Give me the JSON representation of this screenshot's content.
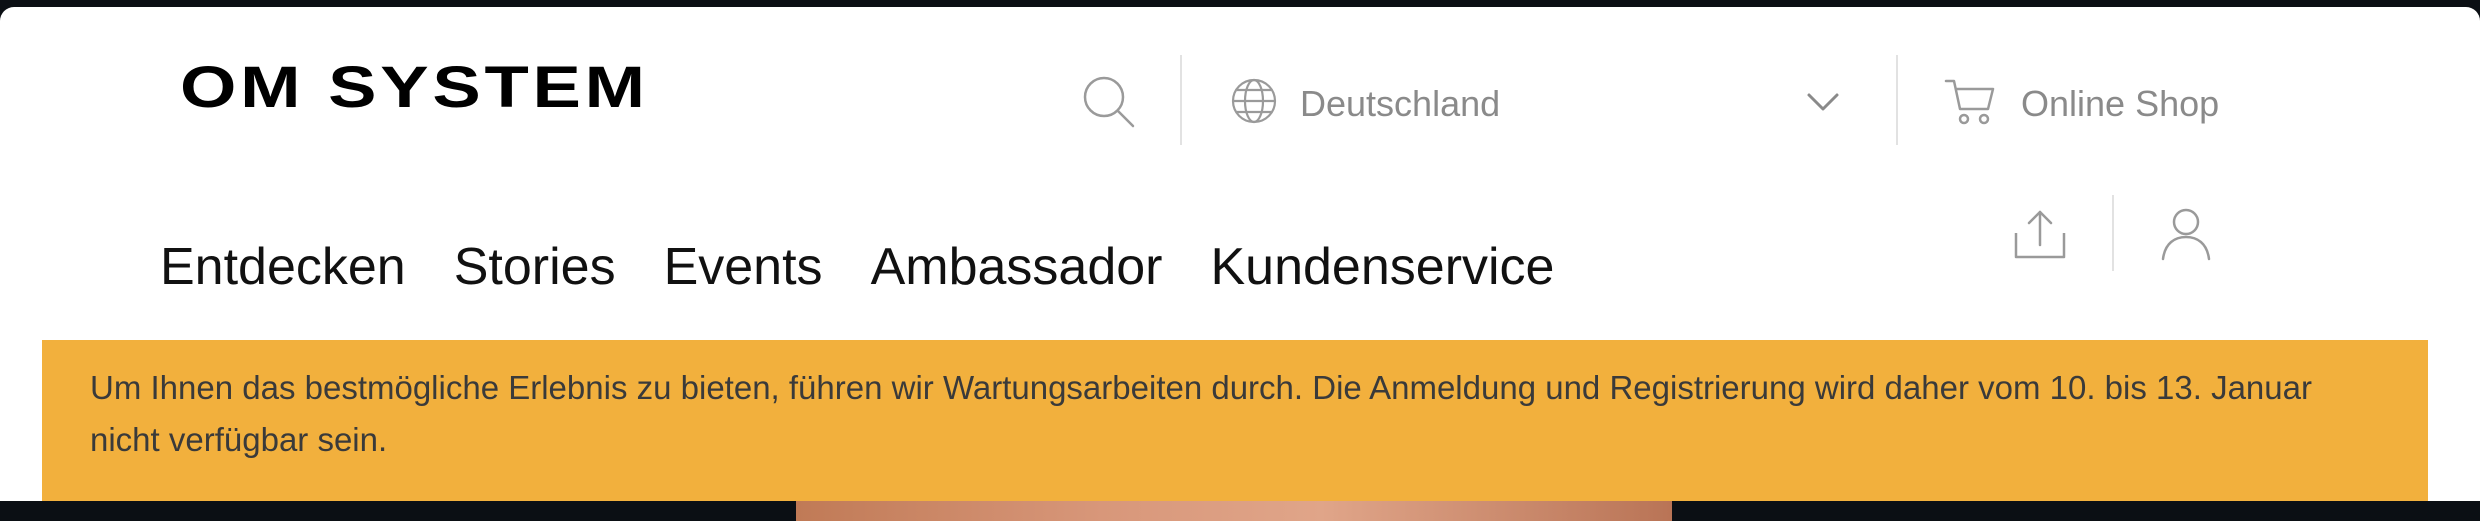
{
  "header": {
    "logo_text": "OM SYSTEM",
    "icons": {
      "search": "search-icon",
      "globe": "globe-icon",
      "chevron": "chevron-down-icon",
      "cart": "cart-icon",
      "share": "share-icon",
      "user": "user-icon"
    },
    "country": "Deutschland",
    "shop_label": "Online Shop"
  },
  "nav": {
    "items": [
      "Entdecken",
      "Stories",
      "Events",
      "Ambassador",
      "Kundenservice"
    ]
  },
  "banner": {
    "text": "Um Ihnen das bestmögliche Erlebnis zu bieten, führen wir Wartungsarbeiten durch. Die Anmeldung und Registrierung wird daher vom 10. bis 13. Januar nicht verfügbar sein.",
    "color": "#f2b03d"
  }
}
